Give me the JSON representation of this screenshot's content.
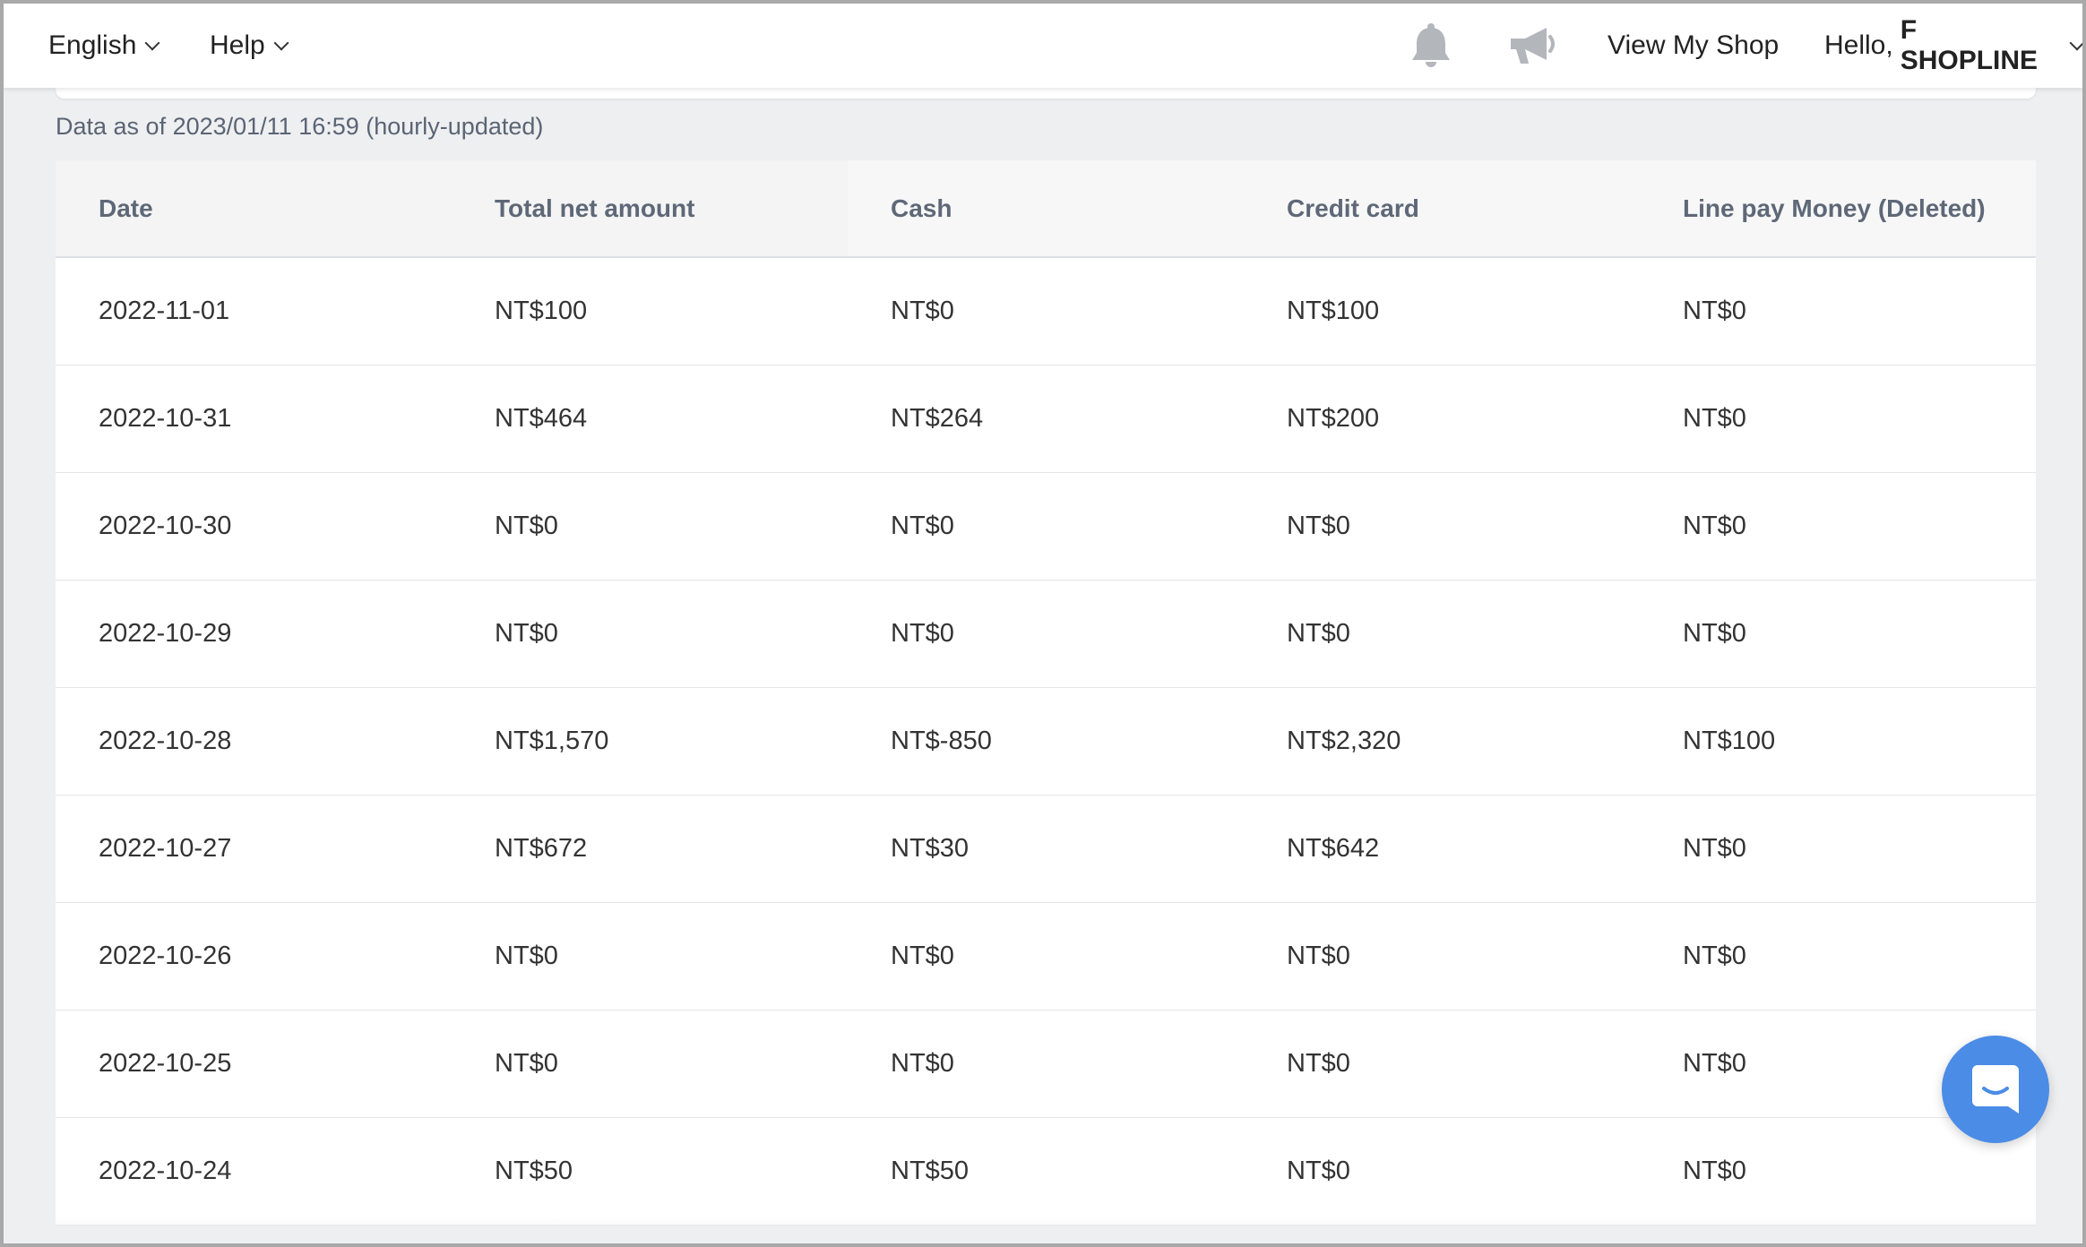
{
  "topbar": {
    "language": "English",
    "help": "Help",
    "view_shop": "View My Shop",
    "greeting": "Hello,",
    "user_name": "F SHOPLINE",
    "icons": [
      "bell-icon",
      "megaphone-icon"
    ]
  },
  "data_as_of": "Data as of 2023/01/11 16:59 (hourly-updated)",
  "table": {
    "columns": [
      "Date",
      "Total net amount",
      "Cash",
      "Credit card",
      "Line pay Money (Deleted)"
    ],
    "rows": [
      [
        "2022-11-01",
        "NT$100",
        "NT$0",
        "NT$100",
        "NT$0"
      ],
      [
        "2022-10-31",
        "NT$464",
        "NT$264",
        "NT$200",
        "NT$0"
      ],
      [
        "2022-10-30",
        "NT$0",
        "NT$0",
        "NT$0",
        "NT$0"
      ],
      [
        "2022-10-29",
        "NT$0",
        "NT$0",
        "NT$0",
        "NT$0"
      ],
      [
        "2022-10-28",
        "NT$1,570",
        "NT$-850",
        "NT$2,320",
        "NT$100"
      ],
      [
        "2022-10-27",
        "NT$672",
        "NT$30",
        "NT$642",
        "NT$0"
      ],
      [
        "2022-10-26",
        "NT$0",
        "NT$0",
        "NT$0",
        "NT$0"
      ],
      [
        "2022-10-25",
        "NT$0",
        "NT$0",
        "NT$0",
        "NT$0"
      ],
      [
        "2022-10-24",
        "NT$50",
        "NT$50",
        "NT$0",
        "NT$0"
      ]
    ]
  },
  "chat_widget": {
    "icon": "chat-icon",
    "color": "#4b8ce6"
  }
}
